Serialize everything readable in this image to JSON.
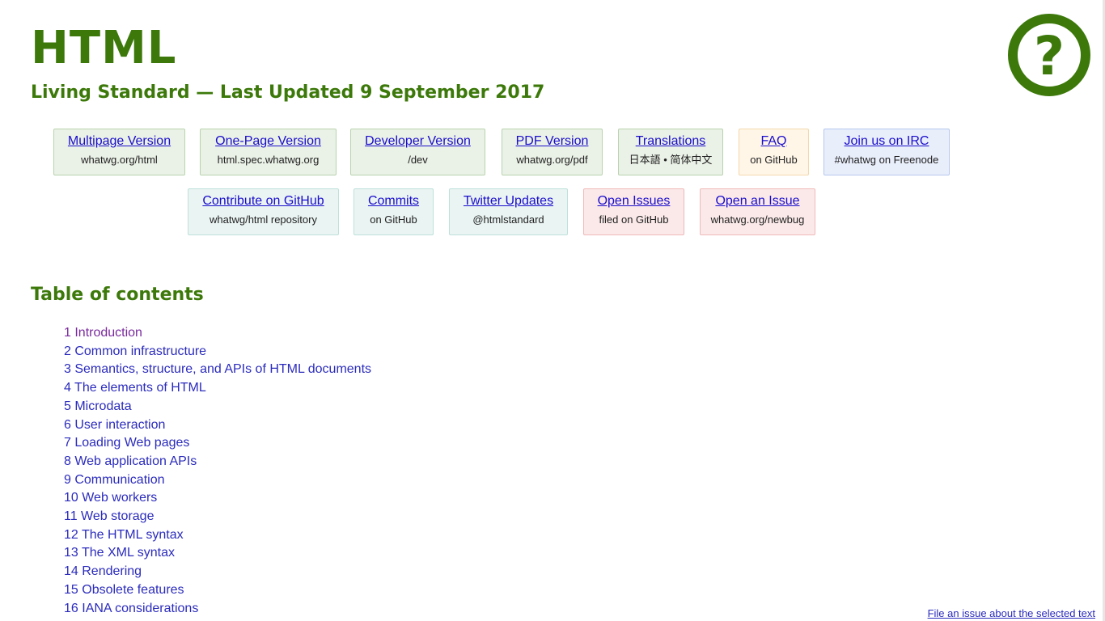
{
  "header": {
    "title": "HTML",
    "subtitle": "Living Standard — Last Updated 9 September 2017"
  },
  "help_logo": {
    "icon": "question-mark-icon",
    "glyph": "?",
    "color": "#3c790a"
  },
  "links_row1": [
    {
      "label": "Multipage Version",
      "sub": "whatwg.org/html",
      "style": "green"
    },
    {
      "label": "One-Page Version",
      "sub": "html.spec.whatwg.org",
      "style": "green"
    },
    {
      "label": "Developer Version",
      "sub": "/dev",
      "style": "green"
    },
    {
      "label": "PDF Version",
      "sub": "whatwg.org/pdf",
      "style": "green"
    },
    {
      "label": "Translations",
      "sub": "日本語 • 简体中文",
      "style": "green"
    },
    {
      "label": "FAQ",
      "sub": "on GitHub",
      "style": "orange"
    },
    {
      "label": "Join us on IRC",
      "sub": "#whatwg on Freenode",
      "style": "blue"
    }
  ],
  "links_row2": [
    {
      "label": "Contribute on GitHub",
      "sub": "whatwg/html repository",
      "style": "teal"
    },
    {
      "label": "Commits",
      "sub": "on GitHub",
      "style": "teal"
    },
    {
      "label": "Twitter Updates",
      "sub": "@htmlstandard",
      "style": "teal"
    },
    {
      "label": "Open Issues",
      "sub": "filed on GitHub",
      "style": "red"
    },
    {
      "label": "Open an Issue",
      "sub": "whatwg.org/newbug",
      "style": "red"
    }
  ],
  "toc": {
    "heading": "Table of contents",
    "items": [
      "1 Introduction",
      "2 Common infrastructure",
      "3 Semantics, structure, and APIs of HTML documents",
      "4 The elements of HTML",
      "5 Microdata",
      "6 User interaction",
      "7 Loading Web pages",
      "8 Web application APIs",
      "9 Communication",
      "10 Web workers",
      "11 Web storage",
      "12 The HTML syntax",
      "13 The XML syntax",
      "14 Rendering",
      "15 Obsolete features",
      "16 IANA considerations"
    ]
  },
  "footer": {
    "file_issue": "File an issue about the selected text"
  },
  "colors": {
    "accent": "#3c790a",
    "link": "#2b2bbd",
    "visited": "#7a2a9e"
  }
}
